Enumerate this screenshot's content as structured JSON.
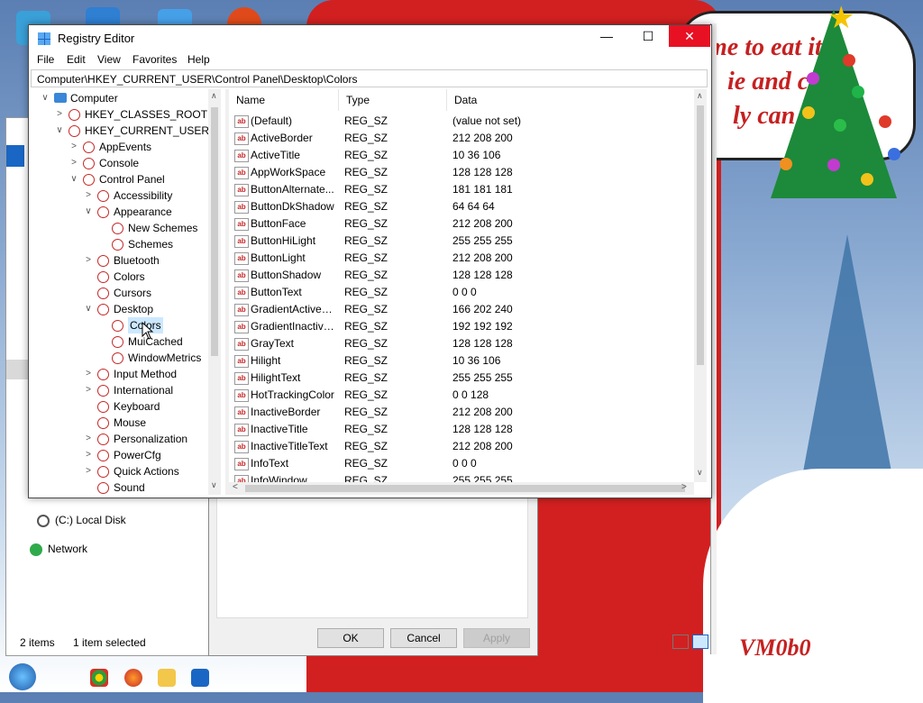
{
  "window": {
    "title": "Registry Editor",
    "minimize": "—",
    "maximize": "☐",
    "close": "✕"
  },
  "menu": [
    "File",
    "Edit",
    "View",
    "Favorites",
    "Help"
  ],
  "address": "Computer\\HKEY_CURRENT_USER\\Control Panel\\Desktop\\Colors",
  "tree": [
    {
      "label": "Computer",
      "depth": 0,
      "chevron": "∨",
      "icon": "computer-icon"
    },
    {
      "label": "HKEY_CLASSES_ROOT",
      "depth": 1,
      "chevron": ">"
    },
    {
      "label": "HKEY_CURRENT_USER",
      "depth": 1,
      "chevron": "∨"
    },
    {
      "label": "AppEvents",
      "depth": 2,
      "chevron": ">"
    },
    {
      "label": "Console",
      "depth": 2,
      "chevron": ">"
    },
    {
      "label": "Control Panel",
      "depth": 2,
      "chevron": "∨"
    },
    {
      "label": "Accessibility",
      "depth": 3,
      "chevron": ">"
    },
    {
      "label": "Appearance",
      "depth": 3,
      "chevron": "∨"
    },
    {
      "label": "New Schemes",
      "depth": 4,
      "chevron": ""
    },
    {
      "label": "Schemes",
      "depth": 4,
      "chevron": ""
    },
    {
      "label": "Bluetooth",
      "depth": 3,
      "chevron": ">"
    },
    {
      "label": "Colors",
      "depth": 3,
      "chevron": ""
    },
    {
      "label": "Cursors",
      "depth": 3,
      "chevron": ""
    },
    {
      "label": "Desktop",
      "depth": 3,
      "chevron": "∨"
    },
    {
      "label": "Colors",
      "depth": 4,
      "chevron": "",
      "selected": true
    },
    {
      "label": "MuiCached",
      "depth": 4,
      "chevron": ""
    },
    {
      "label": "WindowMetrics",
      "depth": 4,
      "chevron": ""
    },
    {
      "label": "Input Method",
      "depth": 3,
      "chevron": ">"
    },
    {
      "label": "International",
      "depth": 3,
      "chevron": ">"
    },
    {
      "label": "Keyboard",
      "depth": 3,
      "chevron": ""
    },
    {
      "label": "Mouse",
      "depth": 3,
      "chevron": ""
    },
    {
      "label": "Personalization",
      "depth": 3,
      "chevron": ">"
    },
    {
      "label": "PowerCfg",
      "depth": 3,
      "chevron": ">"
    },
    {
      "label": "Quick Actions",
      "depth": 3,
      "chevron": ">"
    },
    {
      "label": "Sound",
      "depth": 3,
      "chevron": ""
    }
  ],
  "columns": {
    "name": "Name",
    "type": "Type",
    "data": "Data"
  },
  "values": [
    {
      "name": "(Default)",
      "type": "REG_SZ",
      "data": "(value not set)"
    },
    {
      "name": "ActiveBorder",
      "type": "REG_SZ",
      "data": "212 208 200"
    },
    {
      "name": "ActiveTitle",
      "type": "REG_SZ",
      "data": "10 36 106"
    },
    {
      "name": "AppWorkSpace",
      "type": "REG_SZ",
      "data": "128 128 128"
    },
    {
      "name": "ButtonAlternate...",
      "type": "REG_SZ",
      "data": "181 181 181"
    },
    {
      "name": "ButtonDkShadow",
      "type": "REG_SZ",
      "data": "64 64 64"
    },
    {
      "name": "ButtonFace",
      "type": "REG_SZ",
      "data": "212 208 200"
    },
    {
      "name": "ButtonHiLight",
      "type": "REG_SZ",
      "data": "255 255 255"
    },
    {
      "name": "ButtonLight",
      "type": "REG_SZ",
      "data": "212 208 200"
    },
    {
      "name": "ButtonShadow",
      "type": "REG_SZ",
      "data": "128 128 128"
    },
    {
      "name": "ButtonText",
      "type": "REG_SZ",
      "data": "0 0 0"
    },
    {
      "name": "GradientActiveTi...",
      "type": "REG_SZ",
      "data": "166 202 240"
    },
    {
      "name": "GradientInactive...",
      "type": "REG_SZ",
      "data": "192 192 192"
    },
    {
      "name": "GrayText",
      "type": "REG_SZ",
      "data": "128 128 128"
    },
    {
      "name": "Hilight",
      "type": "REG_SZ",
      "data": "10 36 106"
    },
    {
      "name": "HilightText",
      "type": "REG_SZ",
      "data": "255 255 255"
    },
    {
      "name": "HotTrackingColor",
      "type": "REG_SZ",
      "data": "0 0 128"
    },
    {
      "name": "InactiveBorder",
      "type": "REG_SZ",
      "data": "212 208 200"
    },
    {
      "name": "InactiveTitle",
      "type": "REG_SZ",
      "data": "128 128 128"
    },
    {
      "name": "InactiveTitleText",
      "type": "REG_SZ",
      "data": "212 208 200"
    },
    {
      "name": "InfoText",
      "type": "REG_SZ",
      "data": "0 0 0"
    },
    {
      "name": "InfoWindow",
      "type": "REG_SZ",
      "data": "255 255 255"
    }
  ],
  "explorer": {
    "local_disk": "(C:) Local Disk",
    "network": "Network",
    "status_items": "2 items",
    "status_selected": "1 item selected"
  },
  "dialog": {
    "ok": "OK",
    "cancel": "Cancel",
    "apply": "Apply"
  },
  "desktop": {
    "bubble_lines": [
      "me to eat it",
      "ie and c",
      "ly can"
    ],
    "watermark": "VM0b0"
  },
  "colors": {
    "selection": "#cce8ff",
    "reg_icon": "#c62828",
    "accent": "#1a66c4"
  }
}
